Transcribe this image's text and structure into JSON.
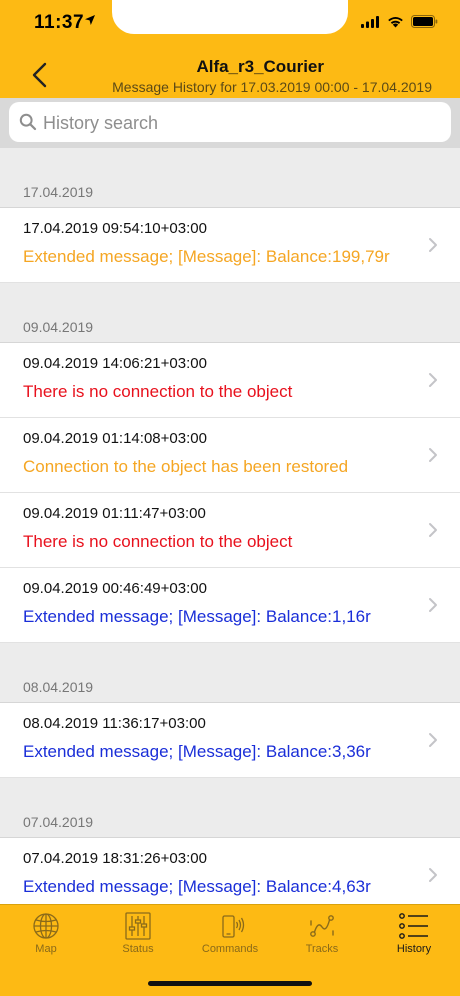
{
  "status_bar": {
    "time": "11:37"
  },
  "nav": {
    "title": "Alfa_r3_Courier",
    "subtitle": "Message History for 17.03.2019 00:00 - 17.04.2019"
  },
  "search": {
    "placeholder": "History search",
    "value": ""
  },
  "sections": [
    {
      "date": "17.04.2019",
      "items": [
        {
          "timestamp": "17.04.2019 09:54:10+03:00",
          "message": "Extended message; [Message]: Balance:199,79r",
          "color": "#f5a623"
        }
      ]
    },
    {
      "date": "09.04.2019",
      "items": [
        {
          "timestamp": "09.04.2019 14:06:21+03:00",
          "message": "There is no connection to the object",
          "color": "#e8111d"
        },
        {
          "timestamp": "09.04.2019 01:14:08+03:00",
          "message": "Connection to the object has been restored",
          "color": "#f5a623"
        },
        {
          "timestamp": "09.04.2019 01:11:47+03:00",
          "message": "There is no connection to the object",
          "color": "#e8111d"
        },
        {
          "timestamp": "09.04.2019 00:46:49+03:00",
          "message": "Extended message; [Message]: Balance:1,16r",
          "color": "#1a2ed8"
        }
      ]
    },
    {
      "date": "08.04.2019",
      "items": [
        {
          "timestamp": "08.04.2019 11:36:17+03:00",
          "message": "Extended message; [Message]: Balance:3,36r",
          "color": "#1a2ed8"
        }
      ]
    },
    {
      "date": "07.04.2019",
      "items": [
        {
          "timestamp": "07.04.2019 18:31:26+03:00",
          "message": "Extended message; [Message]: Balance:4,63r",
          "color": "#1a2ed8"
        }
      ]
    }
  ],
  "tabs": [
    {
      "label": "Map",
      "icon": "globe-icon"
    },
    {
      "label": "Status",
      "icon": "sliders-icon"
    },
    {
      "label": "Commands",
      "icon": "device-signal-icon"
    },
    {
      "label": "Tracks",
      "icon": "route-icon"
    },
    {
      "label": "History",
      "icon": "list-icon",
      "active": true
    }
  ],
  "colors": {
    "accent": "#fdba14",
    "error": "#e8111d",
    "warning": "#f5a623",
    "info": "#1a2ed8"
  }
}
